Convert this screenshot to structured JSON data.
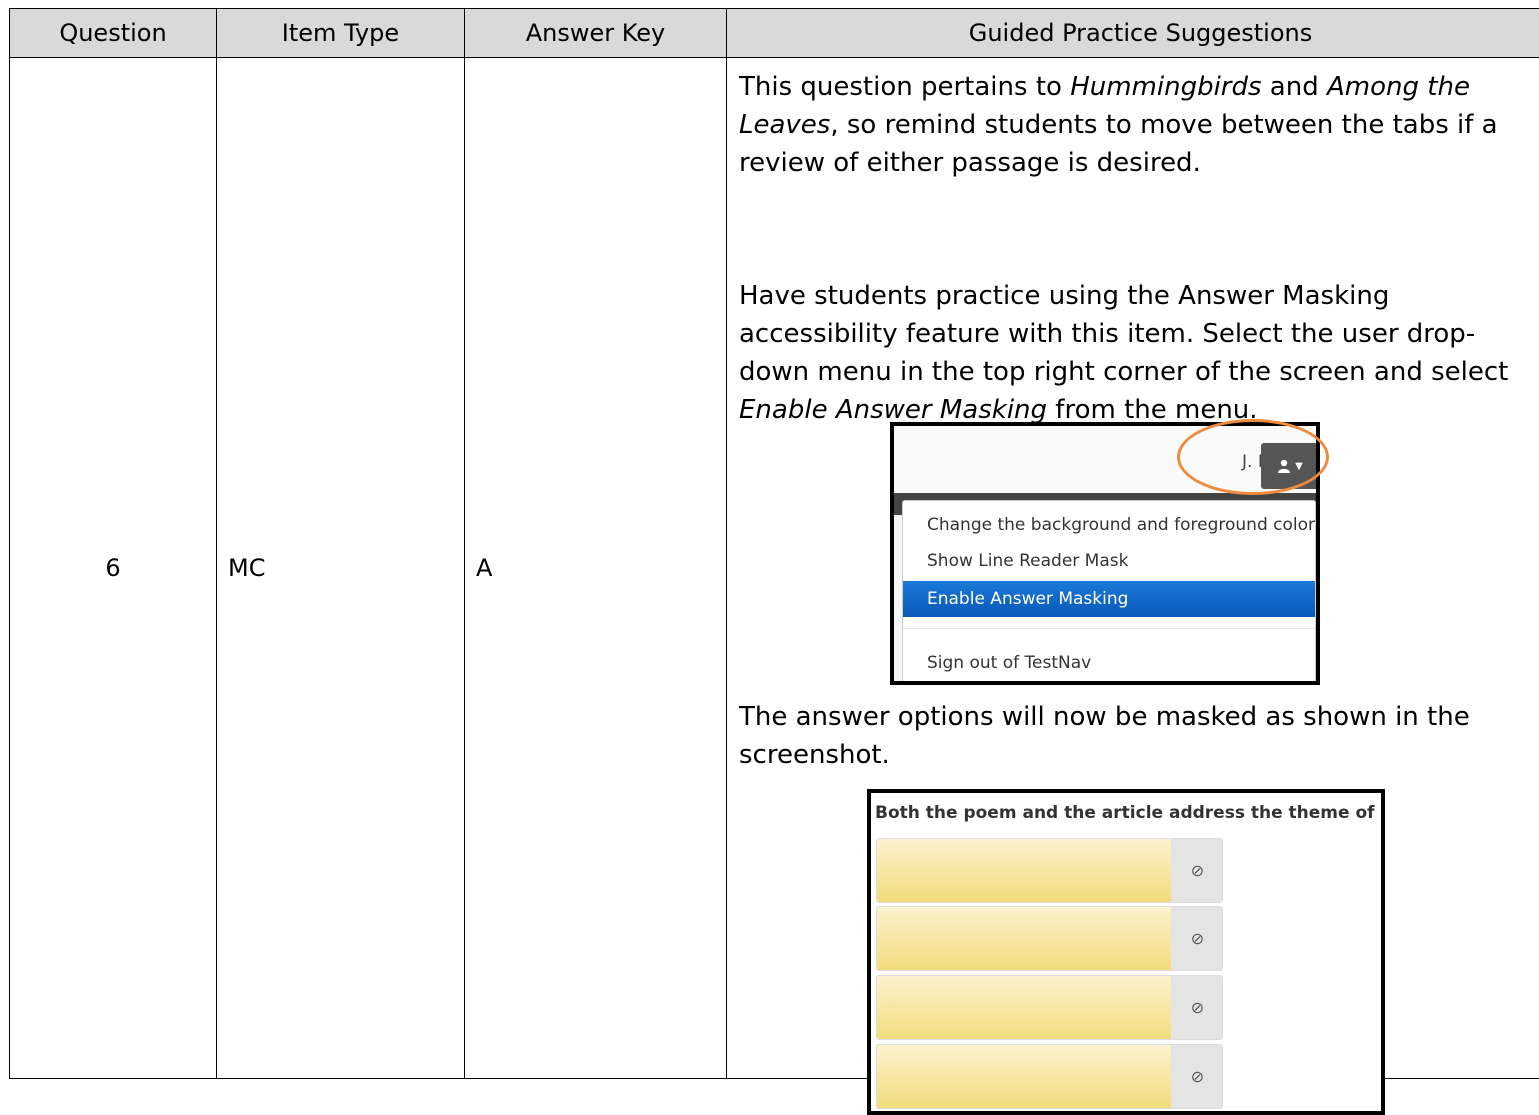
{
  "headers": [
    "Question",
    "Item Type",
    "Answer Key",
    "Guided Practice Suggestions"
  ],
  "row": {
    "question": "6",
    "item_type": "MC",
    "answer_key": "A"
  },
  "suggestions": {
    "p1": {
      "t1": "This question pertains to ",
      "i1": "Hummingbirds",
      "t2": " and ",
      "i2": "Among the Leaves",
      "t3": ", so remind students to move between the tabs if a review of either passage is desired."
    },
    "p2": {
      "t1": "Have students practice using the Answer Masking accessibility feature with this item. Select the user drop-down menu in the top right corner of the screen and select ",
      "i1": "Enable Answer Masking",
      "t2": " from the menu."
    },
    "p3": "The answer options will now be masked as shown in the screenshot."
  },
  "menu_screenshot": {
    "user_name": "J. Doe",
    "items": [
      "Change the background and foreground color",
      "Show Line Reader Mask",
      "Enable Answer Masking",
      "Sign out of TestNav"
    ],
    "selected_index": 2,
    "highlight_color": "#f08a3c"
  },
  "mask_screenshot": {
    "prompt": "Both the poem and the article address the theme of —",
    "option_count": 4,
    "mask_color": "#f3dc7c"
  }
}
